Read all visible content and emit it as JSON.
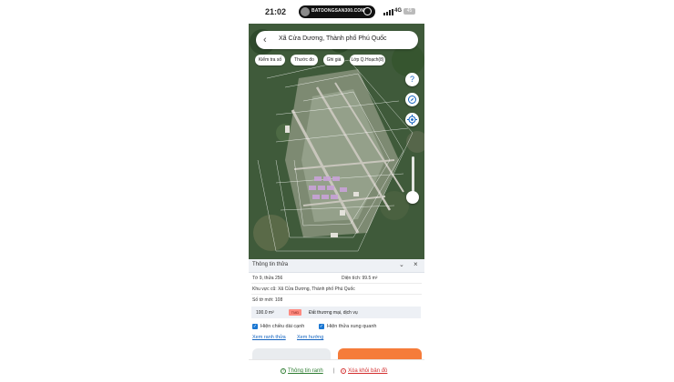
{
  "status_bar": {
    "time": "21:02",
    "island_text": "BATDONGSAN300.COM",
    "network": "4G",
    "battery": "45"
  },
  "search": {
    "back_icon": "chevron-left-icon",
    "query": "Xã Cửa Dương, Thành phố Phú Quốc"
  },
  "chips": [
    "Kiểm tra số",
    "Thước đo",
    "Ghi giá",
    "Lớp Q.Hoạch(8)"
  ],
  "map_controls": {
    "help_icon": "help-icon",
    "compass_icon": "compass-icon",
    "locate_icon": "locate-icon",
    "slider_level": 0.15
  },
  "panel": {
    "title": "Thông tin thửa",
    "sheet_parcel": "Tờ 9, thửa 256",
    "area": "Diện tích: 99.5 m²",
    "old_area": "Khu vực cũ: Xã Cửa Dương, Thành phố Phú Quốc",
    "new_number": "Số tờ mới: 108",
    "zone": {
      "area": "100.0 m²",
      "code": "TMD",
      "use": "Đất thương mại, dịch vụ",
      "color": "#ff8a80"
    },
    "checkboxes": [
      "Hiện chiều dài cạnh",
      "Hiện thửa xung quanh"
    ],
    "links": [
      "Xem ranh thửa",
      "Xem hướng"
    ]
  },
  "bottom_bar": {
    "info_label": "Thông tin ranh",
    "separator": "|",
    "clear_label": "Xóa khỏi bản đồ"
  },
  "colors": {
    "accent": "#1565c0",
    "danger": "#d32f2f",
    "success": "#2e7d32",
    "orange": "#f57c3a"
  }
}
